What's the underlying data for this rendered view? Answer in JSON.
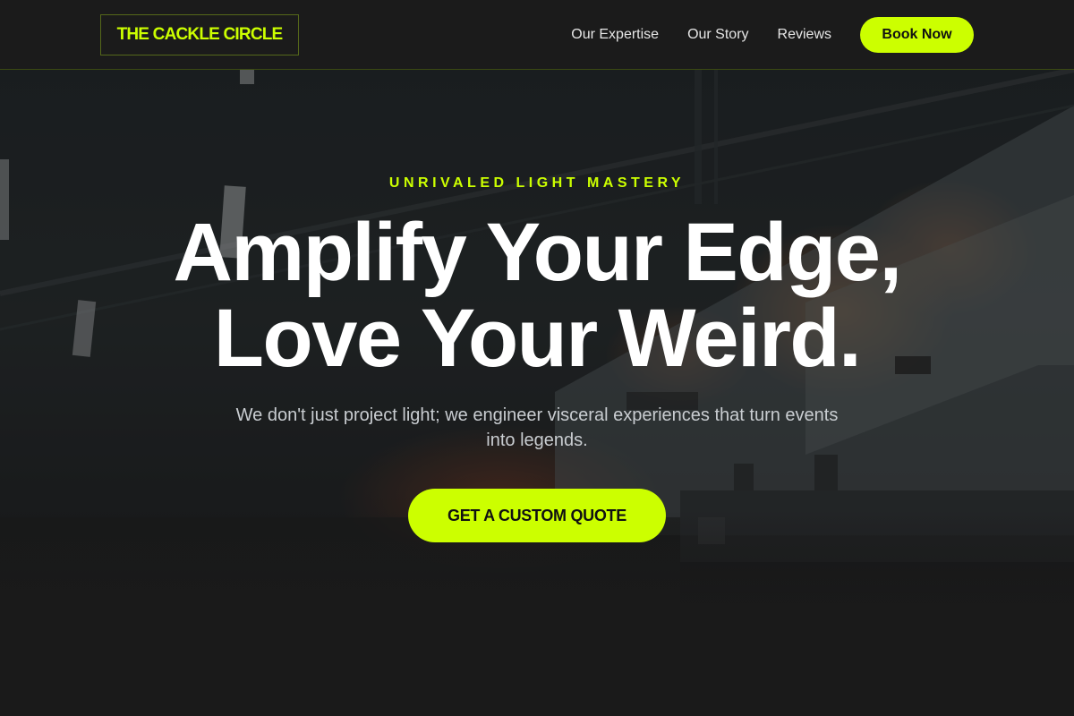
{
  "header": {
    "logo_text": "THE CACKLE CIRCLE",
    "nav_items": [
      {
        "label": "Our Expertise"
      },
      {
        "label": "Our Story"
      },
      {
        "label": "Reviews"
      }
    ],
    "book_button": "Book Now"
  },
  "hero": {
    "eyebrow": "UNRIVALED LIGHT MASTERY",
    "headline_line1": "Amplify Your Edge,",
    "headline_line2": "Love Your Weird.",
    "subtext": "We don't just project light; we engineer visceral experiences that turn events into legends.",
    "cta_button": "GET A CUSTOM QUOTE"
  },
  "colors": {
    "accent": "#ccff00",
    "background": "#1a1a1a",
    "headline": "#ffffff",
    "body_text": "#c9cdd1"
  }
}
